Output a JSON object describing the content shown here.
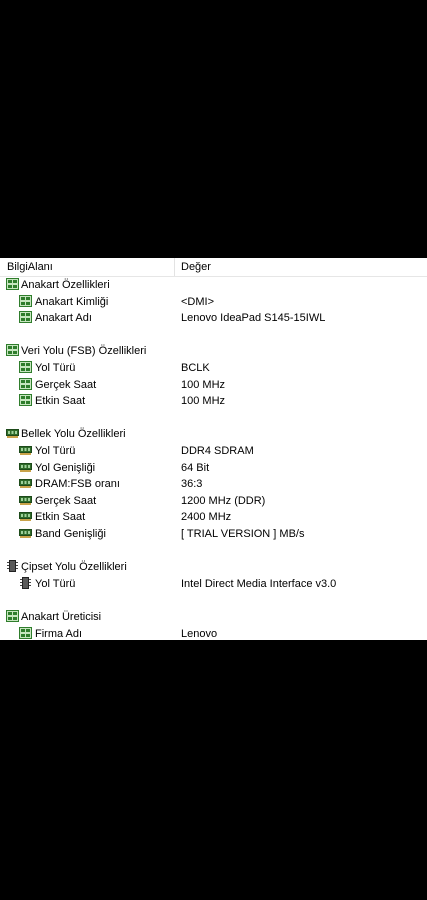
{
  "header": {
    "col1": "BilgiAlanı",
    "col2": "Değer"
  },
  "rows": [
    {
      "kind": "group",
      "icon": "motherboard-icon",
      "label": "Anakart Özellikleri",
      "value": ""
    },
    {
      "kind": "item",
      "icon": "motherboard-icon",
      "label": "Anakart Kimliği",
      "value": "<DMI>"
    },
    {
      "kind": "item",
      "icon": "motherboard-icon",
      "label": "Anakart Adı",
      "value": "Lenovo IdeaPad S145-15IWL"
    },
    {
      "kind": "spacer"
    },
    {
      "kind": "group",
      "icon": "motherboard-icon",
      "label": "Veri Yolu (FSB) Özellikleri",
      "value": ""
    },
    {
      "kind": "item",
      "icon": "motherboard-icon",
      "label": "Yol Türü",
      "value": "BCLK"
    },
    {
      "kind": "item",
      "icon": "motherboard-icon",
      "label": "Gerçek Saat",
      "value": "100 MHz"
    },
    {
      "kind": "item",
      "icon": "motherboard-icon",
      "label": "Etkin Saat",
      "value": "100 MHz"
    },
    {
      "kind": "spacer"
    },
    {
      "kind": "group",
      "icon": "memory-icon",
      "label": "Bellek Yolu Özellikleri",
      "value": ""
    },
    {
      "kind": "item",
      "icon": "memory-icon",
      "label": "Yol Türü",
      "value": "DDR4 SDRAM"
    },
    {
      "kind": "item",
      "icon": "memory-icon",
      "label": "Yol Genişliği",
      "value": "64 Bit"
    },
    {
      "kind": "item",
      "icon": "memory-icon",
      "label": "DRAM:FSB oranı",
      "value": "36:3"
    },
    {
      "kind": "item",
      "icon": "memory-icon",
      "label": "Gerçek Saat",
      "value": "1200 MHz (DDR)"
    },
    {
      "kind": "item",
      "icon": "memory-icon",
      "label": "Etkin Saat",
      "value": "2400 MHz"
    },
    {
      "kind": "item",
      "icon": "memory-icon",
      "label": "Band Genişliği",
      "value": "[ TRIAL VERSION ] MB/s"
    },
    {
      "kind": "spacer"
    },
    {
      "kind": "group",
      "icon": "chipset-icon",
      "label": "Çipset Yolu Özellikleri",
      "value": ""
    },
    {
      "kind": "item",
      "icon": "chipset-icon",
      "label": "Yol Türü",
      "value": "Intel Direct Media Interface v3.0"
    },
    {
      "kind": "spacer"
    },
    {
      "kind": "group",
      "icon": "motherboard-icon",
      "label": "Anakart Üreticisi",
      "value": ""
    },
    {
      "kind": "item",
      "icon": "motherboard-icon",
      "label": "Firma Adı",
      "value": "Lenovo"
    }
  ]
}
